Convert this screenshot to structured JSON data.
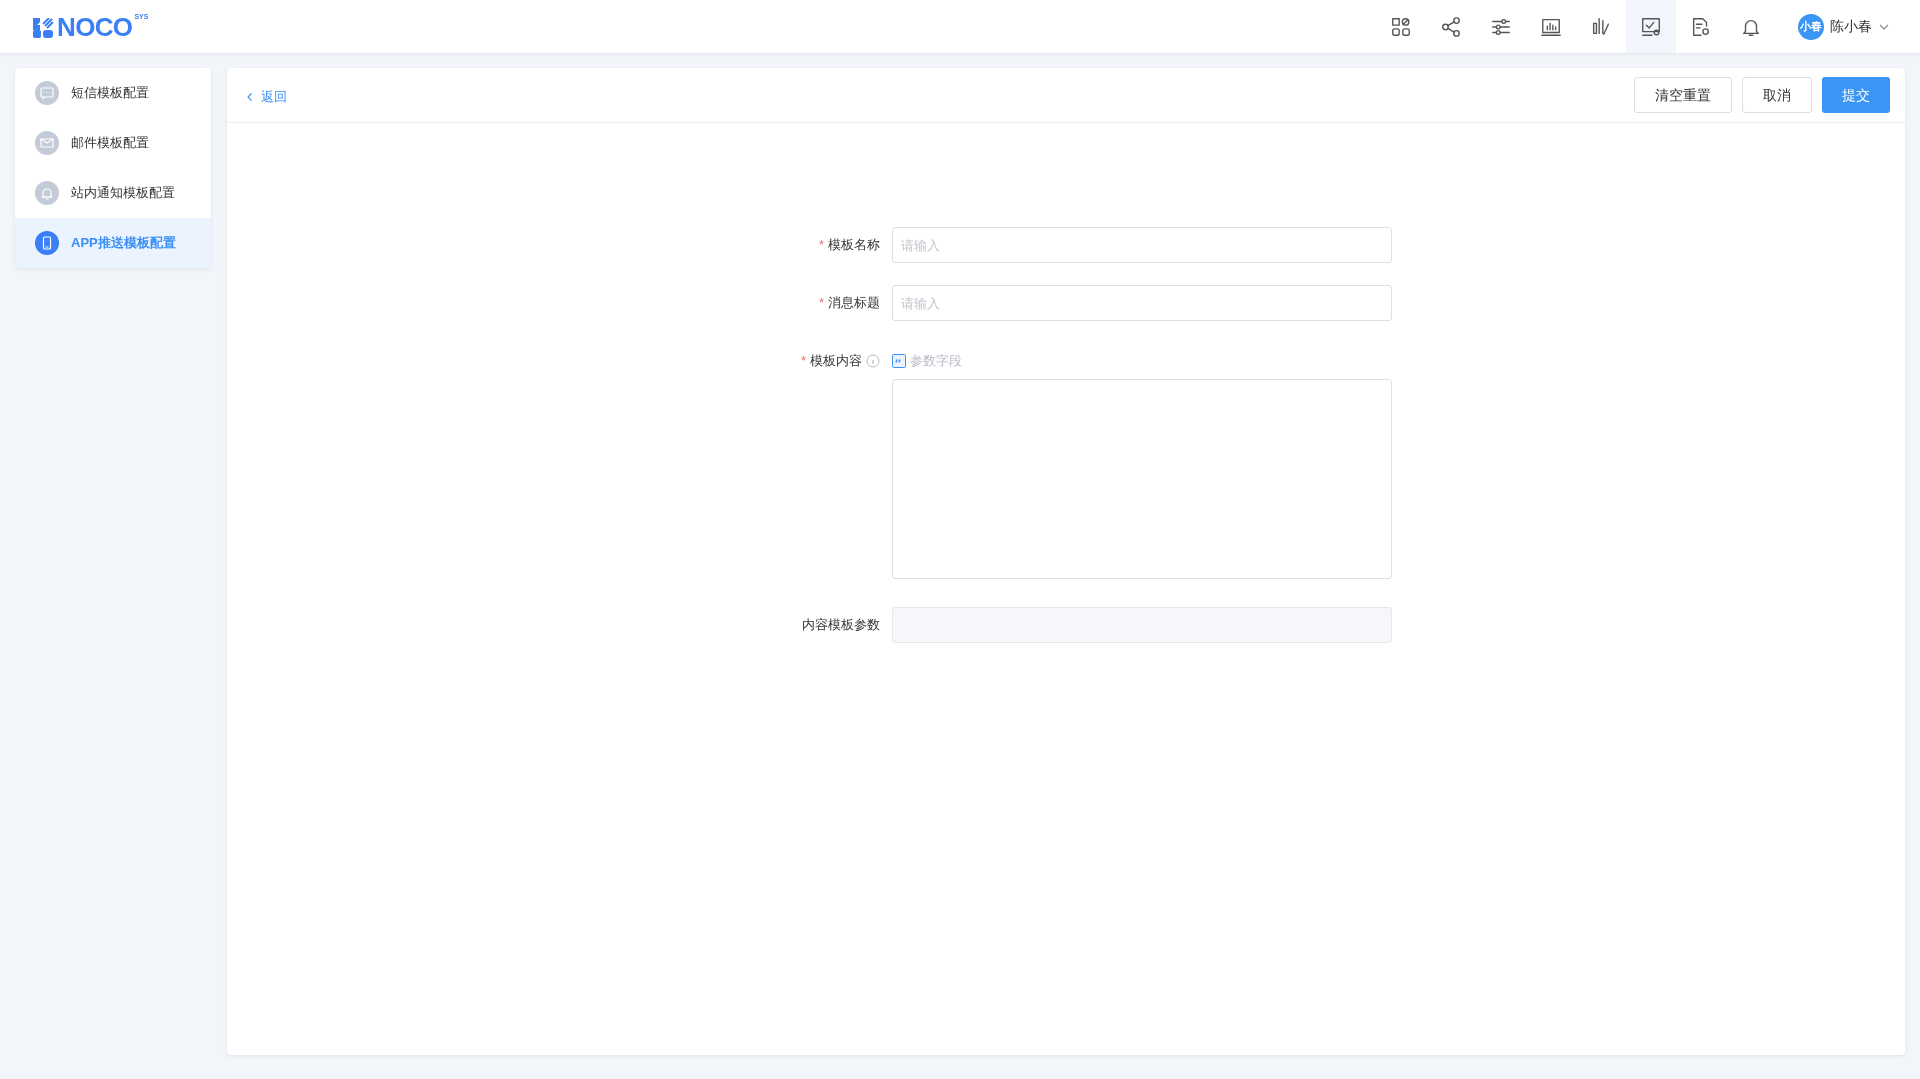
{
  "header": {
    "logo": "NOCO",
    "logo_sup": "SYS",
    "icons": [
      {
        "kind": "apps",
        "selected": false
      },
      {
        "kind": "share",
        "selected": false
      },
      {
        "kind": "sliders",
        "selected": false
      },
      {
        "kind": "monitor",
        "selected": false
      },
      {
        "kind": "bars",
        "selected": false
      },
      {
        "kind": "screen-gear",
        "selected": true
      },
      {
        "kind": "doc-gear",
        "selected": false
      },
      {
        "kind": "bell",
        "selected": false
      }
    ],
    "user": {
      "avatar": "小春",
      "name": "陈小春"
    }
  },
  "sidebar": {
    "items": [
      {
        "label": "短信模板配置",
        "kind": "chat",
        "selected": false
      },
      {
        "label": "邮件模板配置",
        "kind": "mail",
        "selected": false
      },
      {
        "label": "站内通知模板配置",
        "kind": "bell",
        "selected": false
      },
      {
        "label": "APP推送模板配置",
        "kind": "phone",
        "selected": true
      }
    ]
  },
  "toolbar": {
    "back": "返回",
    "buttons": [
      {
        "label": "清空重置",
        "kind": "default"
      },
      {
        "label": "取消",
        "kind": "default"
      },
      {
        "label": "提交",
        "kind": "primary"
      }
    ]
  },
  "form": {
    "fields": [
      {
        "label": "模板名称",
        "required_mark": "*",
        "kind": "input",
        "placeholder": "请输入"
      },
      {
        "label": "消息标题",
        "required_mark": "*",
        "kind": "input",
        "placeholder": "请输入"
      },
      {
        "label": "模板内容",
        "required_mark": "*",
        "kind": "textarea",
        "info": true,
        "insert": "参数字段"
      },
      {
        "label": "内容模板参数",
        "kind": "readonly"
      }
    ]
  }
}
